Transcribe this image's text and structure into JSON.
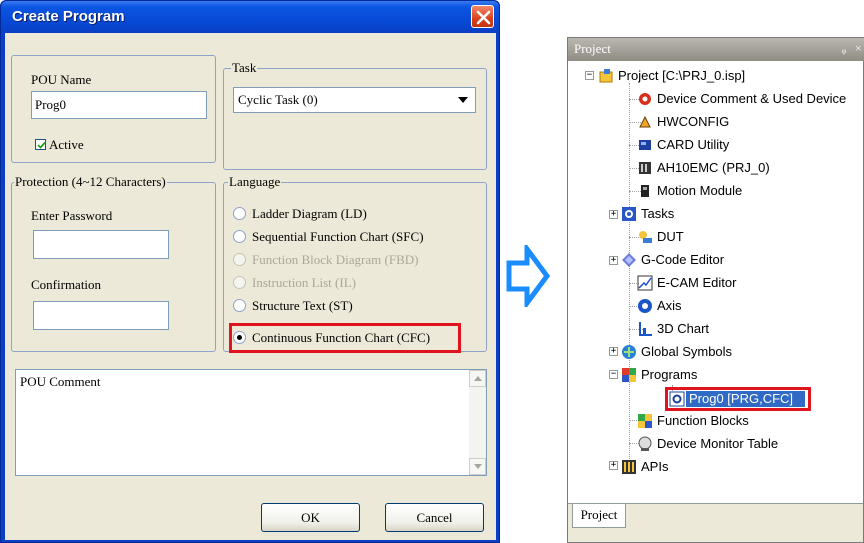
{
  "dialog": {
    "title": "Create Program",
    "pou_name_label": "POU Name",
    "pou_name_value": "Prog0",
    "active_label": "Active",
    "task_legend": "Task",
    "task_value": "Cyclic Task (0)",
    "protection_legend": "Protection (4~12 Characters)",
    "enter_password_label": "Enter Password",
    "confirmation_label": "Confirmation",
    "language_legend": "Language",
    "languages": [
      {
        "label": "Ladder Diagram (LD)",
        "enabled": true,
        "selected": false
      },
      {
        "label": "Sequential Function Chart (SFC)",
        "enabled": true,
        "selected": false
      },
      {
        "label": "Function Block Diagram (FBD)",
        "enabled": false,
        "selected": false
      },
      {
        "label": "Instruction List (IL)",
        "enabled": false,
        "selected": false
      },
      {
        "label": "Structure Text (ST)",
        "enabled": true,
        "selected": false
      },
      {
        "label": "Continuous Function Chart (CFC)",
        "enabled": true,
        "selected": true
      }
    ],
    "comment_text": "POU Comment",
    "ok_label": "OK",
    "cancel_label": "Cancel"
  },
  "panel": {
    "title": "Project",
    "tab_label": "Project",
    "tree": [
      {
        "label": "Project [C:\\PRJ_0.isp]",
        "icon": "project-icon"
      },
      {
        "label": "Device Comment & Used Device",
        "icon": "device-comment-icon"
      },
      {
        "label": "HWCONFIG",
        "icon": "hwconfig-icon"
      },
      {
        "label": "CARD Utility",
        "icon": "card-utility-icon"
      },
      {
        "label": "AH10EMC  (PRJ_0)",
        "icon": "module-icon"
      },
      {
        "label": "Motion Module",
        "icon": "motion-module-icon"
      },
      {
        "label": "Tasks",
        "icon": "tasks-icon"
      },
      {
        "label": "DUT",
        "icon": "dut-icon"
      },
      {
        "label": "G-Code Editor",
        "icon": "gcode-icon"
      },
      {
        "label": "E-CAM Editor",
        "icon": "ecam-icon"
      },
      {
        "label": "Axis",
        "icon": "axis-icon"
      },
      {
        "label": "3D Chart",
        "icon": "chart3d-icon"
      },
      {
        "label": "Global Symbols",
        "icon": "global-symbols-icon"
      },
      {
        "label": "Programs",
        "icon": "programs-icon"
      },
      {
        "label": "Prog0 [PRG,CFC]",
        "icon": "cfc-program-icon"
      },
      {
        "label": "Function Blocks",
        "icon": "function-blocks-icon"
      },
      {
        "label": "Device Monitor Table",
        "icon": "monitor-table-icon"
      },
      {
        "label": "APIs",
        "icon": "apis-icon"
      }
    ]
  },
  "colors": {
    "titlebar": "#0b55e3",
    "highlight": "#e0141e",
    "selection": "#316ac5",
    "arrow": "#1a8cff"
  }
}
